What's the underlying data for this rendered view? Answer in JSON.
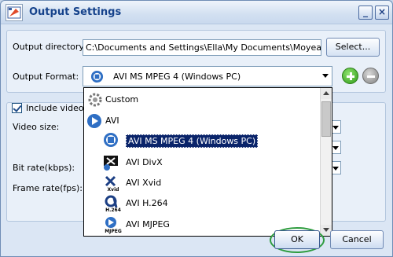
{
  "window": {
    "title": "Output Settings"
  },
  "output_directory": {
    "label": "Output directory:",
    "value": "C:\\Documents and Settings\\Ella\\My Documents\\Moyea\\FLV to Vi",
    "select_label": "Select..."
  },
  "output_format": {
    "label": "Output Format:",
    "selected": "AVI MS MPEG 4 (Windows PC)"
  },
  "video": {
    "include_label": "Include video",
    "include_checked": true,
    "video_size_label": "Video size:",
    "bit_rate_label": "Bit rate(kbps):",
    "frame_rate_label": "Frame rate(fps):"
  },
  "dropdown": {
    "items": [
      {
        "label": "Custom",
        "icon": "gear-icon"
      },
      {
        "label": "AVI",
        "icon": "play-circle-icon"
      },
      {
        "label": "AVI MS MPEG 4 (Windows PC)",
        "icon": "windows-media-icon",
        "selected": true
      },
      {
        "label": "AVI DivX",
        "icon": "divx-icon"
      },
      {
        "label": "AVI Xvid",
        "icon": "xvid-icon",
        "caption": "Xvid"
      },
      {
        "label": "AVI H.264",
        "icon": "h264-icon",
        "caption": "H.264"
      },
      {
        "label": "AVI MJPEG",
        "icon": "mjpeg-icon",
        "caption": "MJPEG"
      }
    ]
  },
  "buttons": {
    "ok": "OK",
    "cancel": "Cancel"
  },
  "colors": {
    "selection": "#0a246a",
    "title_text": "#15428b",
    "ok_highlight": "#2e9c3f"
  }
}
